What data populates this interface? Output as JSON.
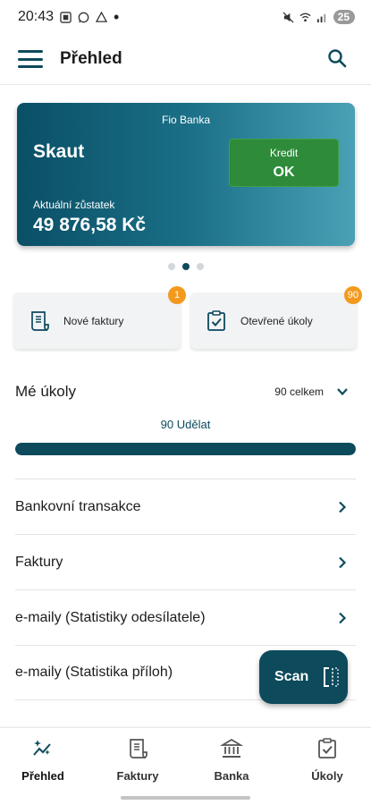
{
  "status_bar": {
    "time": "20:43",
    "battery": "25"
  },
  "app_bar": {
    "title": "Přehled"
  },
  "card": {
    "bank_name": "Fio Banka",
    "title": "Skaut",
    "credit_label": "Kredit",
    "credit_value": "OK",
    "balance_label": "Aktuální zůstatek",
    "balance_value": "49 876,58 Kč",
    "colors": {
      "gradient_start": "#0a4f66",
      "gradient_end": "#4aa1b6",
      "credit_bg": "#2e8b3a"
    }
  },
  "carousel": {
    "active_index": 1,
    "dot_count": 3
  },
  "tiles": {
    "invoices": {
      "label": "Nové faktury",
      "badge": "1"
    },
    "tasks": {
      "label": "Otevřené úkoly",
      "badge": "90"
    }
  },
  "my_tasks": {
    "title": "Mé úkoly",
    "count": "90 celkem",
    "todo": "90 Udělat",
    "progress": 1.0
  },
  "list": [
    {
      "label": "Bankovní transakce"
    },
    {
      "label": "Faktury"
    },
    {
      "label": "e-maily (Statistiky odesílatele)"
    },
    {
      "label": "e-maily (Statistika příloh)"
    }
  ],
  "fab": {
    "label": "Scan"
  },
  "bottom_nav": [
    {
      "label": "Přehled",
      "icon": "overview-sparkle-icon",
      "active": true
    },
    {
      "label": "Faktury",
      "icon": "invoice-icon",
      "active": false
    },
    {
      "label": "Banka",
      "icon": "bank-icon",
      "active": false
    },
    {
      "label": "Úkoly",
      "icon": "tasks-check-icon",
      "active": false
    }
  ],
  "colors": {
    "accent": "#0d4a5c",
    "badge": "#f39a1e"
  }
}
